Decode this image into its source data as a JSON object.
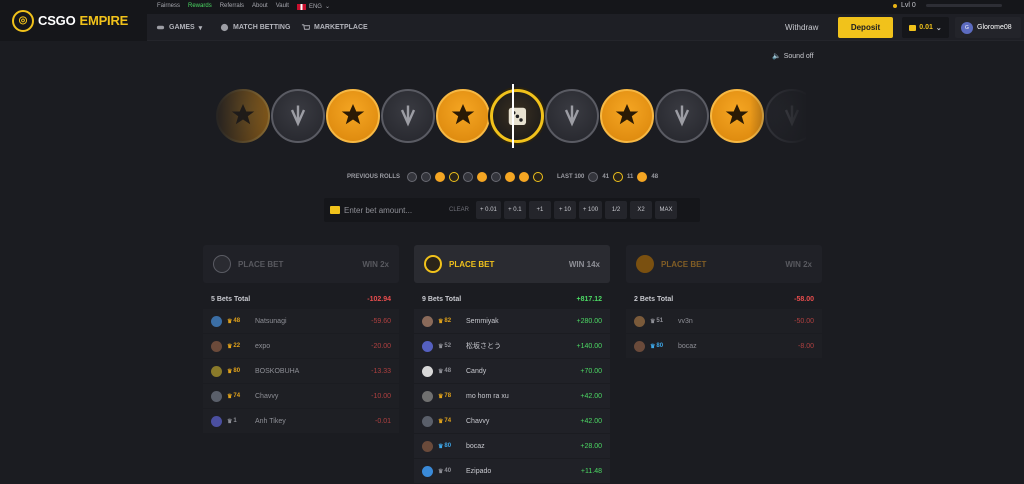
{
  "brand": {
    "part1": "CSGO",
    "part2": "EMPIRE"
  },
  "toplinks": [
    {
      "label": "Fairness"
    },
    {
      "label": "Rewards"
    },
    {
      "label": "Referrals"
    },
    {
      "label": "About"
    },
    {
      "label": "Vault"
    }
  ],
  "language": "ENG",
  "level": "Lvl 0",
  "nav": {
    "games": "GAMES",
    "match_betting": "MATCH BETTING",
    "marketplace": "MARKETPLACE"
  },
  "header": {
    "withdraw": "Withdraw",
    "deposit": "Deposit",
    "balance": "0.01",
    "username": "Glorome08",
    "avatar_initial": "G"
  },
  "sound": "Sound off",
  "previous_rolls": {
    "label": "PREVIOUS ROLLS",
    "rolls": [
      "ct",
      "ct",
      "t",
      "bonus",
      "ct",
      "t",
      "ct",
      "t",
      "t",
      "bonus"
    ]
  },
  "last100": {
    "label": "LAST 100",
    "ct": "41",
    "bonus": "11",
    "t": "48"
  },
  "bet": {
    "placeholder": "Enter bet amount...",
    "clear": "CLEAR",
    "buttons": [
      "+ 0.01",
      "+ 0.1",
      "+1",
      "+ 10",
      "+ 100",
      "1/2",
      "X2",
      "MAX"
    ]
  },
  "columns": [
    {
      "key": "ct",
      "label": "PLACE BET",
      "win": "WIN 2x",
      "total_label": "5 Bets Total",
      "total": "-102.94",
      "rows": [
        {
          "level": "48",
          "name": "Natsunagi",
          "amount": "-59.60",
          "color": "#3b6ea5"
        },
        {
          "level": "22",
          "name": "expo",
          "amount": "-20.00",
          "color": "#6b4a3a"
        },
        {
          "level": "80",
          "name": "BOSKOBUHA",
          "amount": "-13.33",
          "color": "#8a7a2a"
        },
        {
          "level": "74",
          "name": "Chavvy",
          "amount": "-10.00",
          "color": "#5a5f6a"
        },
        {
          "level": "1",
          "name": "Anh Tikey",
          "amount": "-0.01",
          "color": "#4b4fa0"
        }
      ]
    },
    {
      "key": "bonus",
      "label": "PLACE BET",
      "win": "WIN 14x",
      "total_label": "9 Bets Total",
      "total": "+817.12",
      "rows": [
        {
          "level": "82",
          "name": "Semmiyak",
          "amount": "+280.00",
          "color": "#8a6a5a"
        },
        {
          "level": "52",
          "name": "松坂さとう",
          "amount": "+140.00",
          "color": "#5560c0"
        },
        {
          "level": "48",
          "name": "Candy",
          "amount": "+70.00",
          "color": "#d8d8d8"
        },
        {
          "level": "78",
          "name": "mo hom ra xu",
          "amount": "+42.00",
          "color": "#707070"
        },
        {
          "level": "74",
          "name": "Chavvy",
          "amount": "+42.00",
          "color": "#5a5f6a"
        },
        {
          "level": "80",
          "name": "bocaz",
          "amount": "+28.00",
          "color": "#6a4a3a"
        },
        {
          "level": "40",
          "name": "Ezipado",
          "amount": "+11.48",
          "color": "#3a8ad8"
        }
      ]
    },
    {
      "key": "t",
      "label": "PLACE BET",
      "win": "WIN 2x",
      "total_label": "2 Bets Total",
      "total": "-58.00",
      "rows": [
        {
          "level": "51",
          "name": "vv3n",
          "amount": "-50.00",
          "color": "#7a5a3a"
        },
        {
          "level": "80",
          "name": "bocaz",
          "amount": "-8.00",
          "color": "#6a4a3a"
        }
      ]
    }
  ],
  "colors": {
    "accent": "#f1c21b",
    "t_orange": "#f5a623",
    "positive": "#4cd964",
    "negative": "#e94d4d"
  }
}
